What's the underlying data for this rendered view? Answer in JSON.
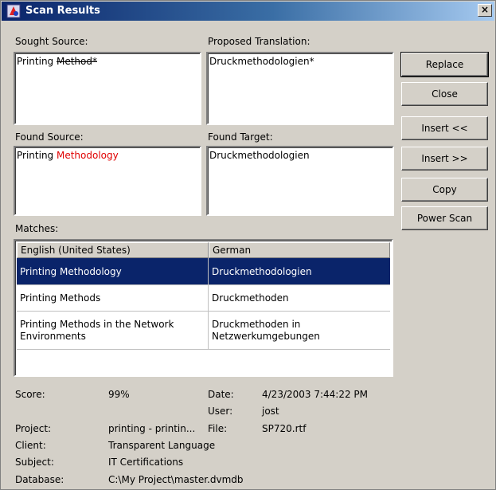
{
  "window": {
    "title": "Scan Results",
    "close_glyph": "×"
  },
  "labels": {
    "sought_source": "Sought Source:",
    "proposed_translation": "Proposed Translation:",
    "found_source": "Found Source:",
    "found_target": "Found Target:",
    "matches": "Matches:"
  },
  "fields": {
    "sought_source_plain": "Printing ",
    "sought_source_struck": "Method*",
    "proposed_translation": "Druckmethodologien*",
    "found_source_plain": "Printing ",
    "found_source_highlight": "Methodology",
    "found_target": "Druckmethodologien"
  },
  "buttons": {
    "replace": "Replace",
    "close": "Close",
    "insert_left": "Insert <<",
    "insert_right": "Insert >>",
    "copy": "Copy",
    "power_scan": "Power Scan"
  },
  "matches": {
    "columns": [
      "English (United States)",
      "German"
    ],
    "rows": [
      {
        "source": "Printing Methodology",
        "target": "Druckmethodologien",
        "selected": true
      },
      {
        "source": "Printing Methods",
        "target": "Druckmethoden",
        "selected": false
      },
      {
        "source": "Printing Methods in the Network Environments",
        "target": "Druckmethoden in Netzwerkumgebungen",
        "selected": false
      }
    ]
  },
  "details": {
    "score_label": "Score:",
    "score_value": "99%",
    "date_label": "Date:",
    "date_value": "4/23/2003 7:44:22 PM",
    "user_label": "User:",
    "user_value": "jost",
    "project_label": "Project:",
    "project_value": "printing - printin...",
    "file_label": "File:",
    "file_value": "SP720.rtf",
    "client_label": "Client:",
    "client_value": "Transparent Language",
    "subject_label": "Subject:",
    "subject_value": "IT Certifications",
    "database_label": "Database:",
    "database_value": "C:\\My Project\\master.dvmdb"
  },
  "colors": {
    "title_bar": "#0a246a",
    "selection": "#0a246a",
    "highlight_text": "#e00000"
  }
}
